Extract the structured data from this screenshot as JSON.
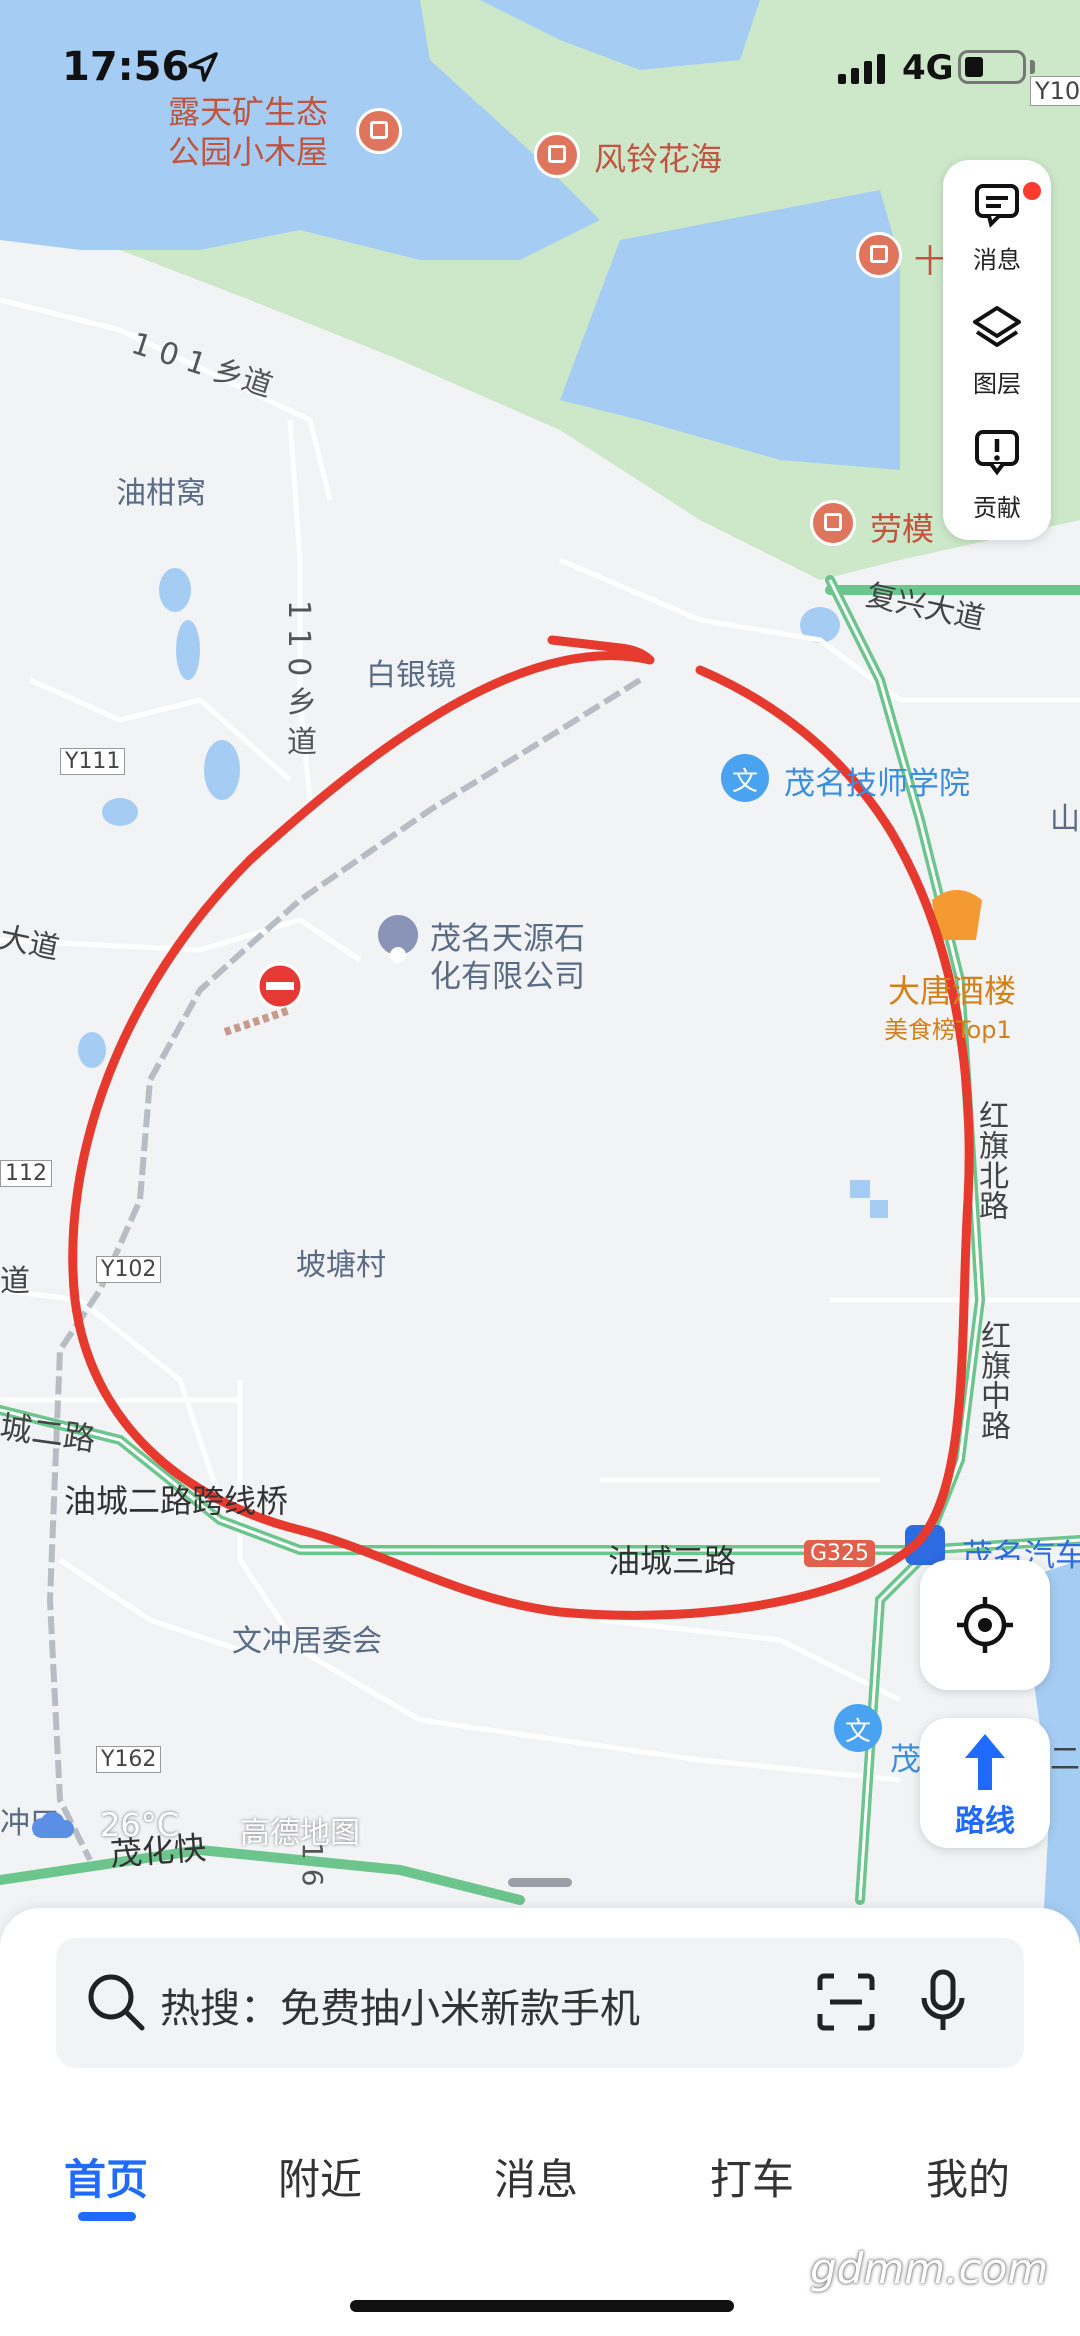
{
  "status_bar": {
    "time": "17:56",
    "network": "4G"
  },
  "map": {
    "top_labels": {
      "poi_1": "露天矿生态\n公园小木屋",
      "poi_2": "风铃花海",
      "poi_3": "十",
      "poi_4": "劳模",
      "road_101": "1 0 1 乡道",
      "village_1": "油柑窝",
      "road_y10": "Y10"
    },
    "labels": {
      "baiyinjing": "白银镜",
      "road_110": "1 1 0 乡 道",
      "fuxing": "复兴大道",
      "y111": "Y111",
      "school": "茂名技师学院",
      "shan": "山",
      "dadao_left": "大道",
      "tianyuan": "茂名天源石化有限公司",
      "datang": "大唐酒楼",
      "datang_sub": "美食榜Top1",
      "hongqi_north": "红旗北路",
      "y112": "112",
      "dao_left": "道",
      "y102": "Y102",
      "potang": "坡塘村",
      "hongqi_middle": "红旗中路",
      "road_cheng2": "城二路",
      "bridge": "油城二路跨线桥",
      "road_cheng3": "油城三路",
      "g325": "G325",
      "maoming_auto": "茂名汽车",
      "wenchong": "文冲居委会",
      "y162": "Y162",
      "mao_bottom": "茂",
      "chong_left": "冲口",
      "maohua": "茂化快",
      "road_16": "1 6",
      "er": "二",
      "mao_right": "茂"
    },
    "weather": "26°C",
    "brand": "高德地图"
  },
  "side_panel": {
    "items": [
      {
        "label": "消息",
        "icon": "message-icon"
      },
      {
        "label": "图层",
        "icon": "layers-icon"
      },
      {
        "label": "贡献",
        "icon": "report-icon"
      }
    ]
  },
  "route_button": {
    "label": "路线"
  },
  "search": {
    "hot_text": "热搜：免费抽小米新款手机"
  },
  "tabs": [
    {
      "label": "首页",
      "active": true
    },
    {
      "label": "附近",
      "active": false
    },
    {
      "label": "消息",
      "active": false
    },
    {
      "label": "打车",
      "active": false
    },
    {
      "label": "我的",
      "active": false
    }
  ],
  "watermark": "gdmm.com",
  "colors": {
    "accent": "#1f6bff",
    "water": "#a5cdf4",
    "park": "#cde8c9",
    "highway": "#6cc58c",
    "annotation": "#e63a2e",
    "poi": "#e0755e"
  }
}
